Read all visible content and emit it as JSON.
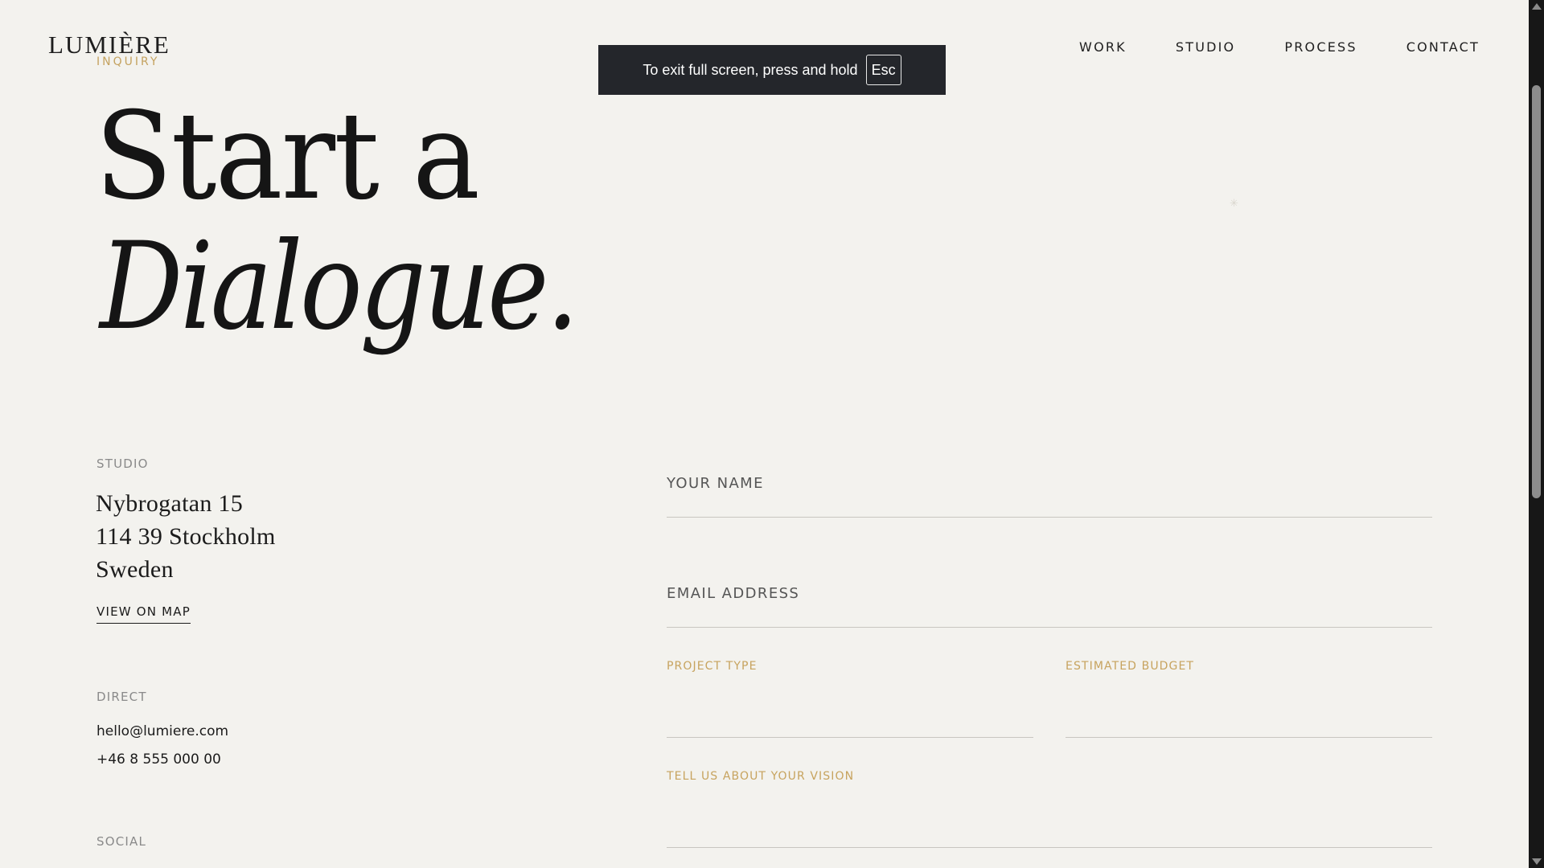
{
  "header": {
    "logo": "LUMIÈRE",
    "eyebrow": "INQUIRY",
    "nav": [
      "WORK",
      "STUDIO",
      "PROCESS",
      "CONTACT"
    ]
  },
  "fullscreen_notice": {
    "text": "To exit full screen, press and hold",
    "key": "Esc"
  },
  "hero": {
    "line1": "Start a",
    "line2": "Dialogue."
  },
  "studio": {
    "label": "STUDIO",
    "address": [
      "Nybrogatan 15",
      "114 39 Stockholm",
      "Sweden"
    ],
    "map_link": "VIEW ON MAP"
  },
  "direct": {
    "label": "DIRECT",
    "email": "hello@lumiere.com",
    "phone": "+46 8 555 000 00"
  },
  "social": {
    "label": "SOCIAL"
  },
  "form": {
    "name_label": "YOUR NAME",
    "email_label": "EMAIL ADDRESS",
    "project_type_label": "PROJECT TYPE",
    "budget_label": "ESTIMATED BUDGET",
    "vision_label": "TELL US ABOUT YOUR VISION"
  },
  "colors": {
    "background": "#f3f2ee",
    "accent_gold": "#c7a35e",
    "text": "#1b1b1b",
    "toast_bg": "#24262b"
  }
}
